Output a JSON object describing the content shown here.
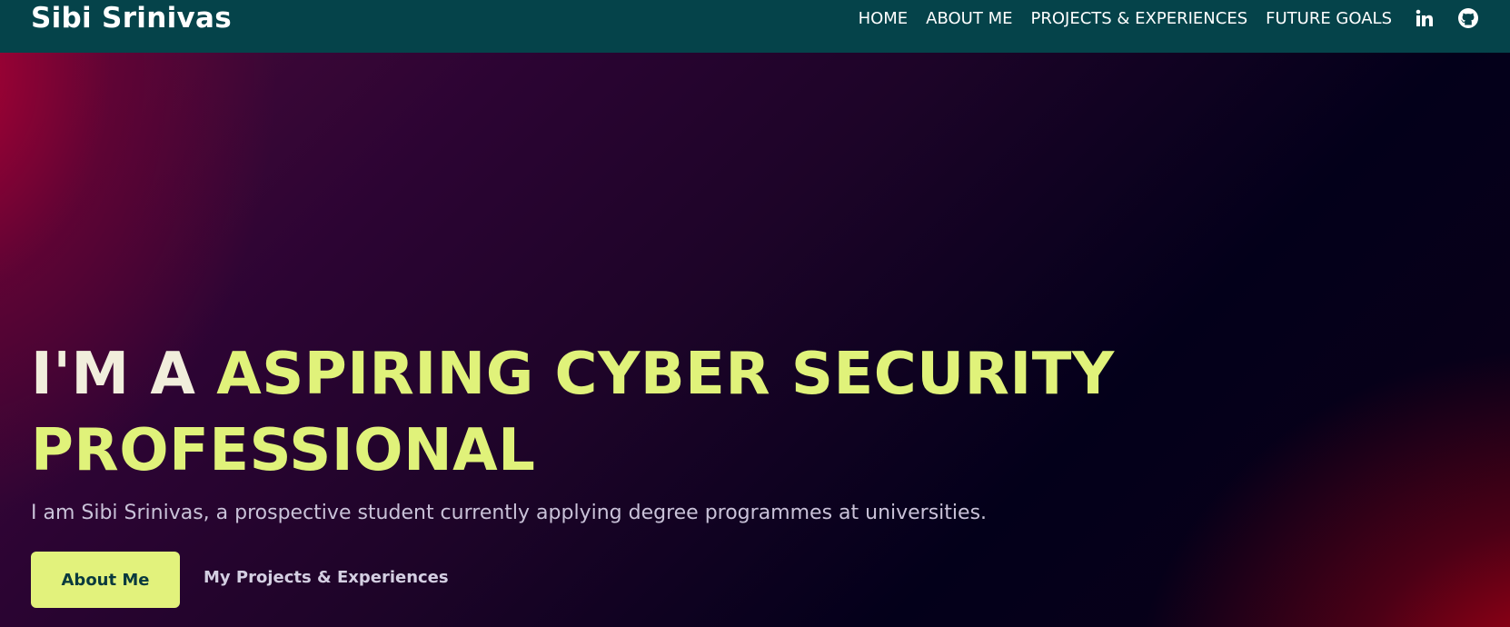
{
  "brand": "Sibi Srinivas",
  "nav": {
    "links": [
      "HOME",
      "ABOUT ME",
      "PROJECTS & EXPERIENCES",
      "FUTURE GOALS"
    ],
    "icons": [
      "linkedin-icon",
      "github-icon"
    ]
  },
  "hero": {
    "headline_lead": "I'M A ",
    "headline_accent_1": "ASPIRING CYBER SECURITY",
    "headline_accent_2": "PROFESSIONAL",
    "subtitle": "I am Sibi Srinivas, a prospective student currently applying degree programmes at universities.",
    "primary_button": "About Me",
    "secondary_link": "My Projects & Experiences"
  },
  "colors": {
    "navbar": "#05434a",
    "accent": "#e2f27c",
    "headline_light": "#f1eedc",
    "button_text": "#0a3a3e"
  }
}
